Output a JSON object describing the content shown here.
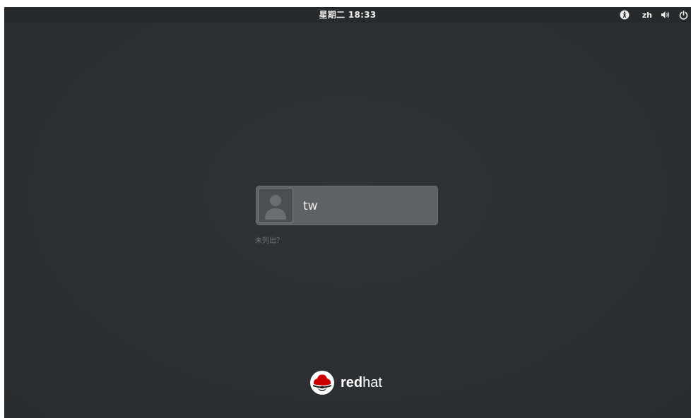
{
  "topbar": {
    "clock": "星期二 18:33",
    "tray": {
      "accessibility_icon": "accessibility-icon",
      "language": "zh",
      "volume_icon": "volume-icon",
      "power_icon": "power-icon"
    }
  },
  "login": {
    "users": [
      {
        "name": "tw",
        "avatar_icon": "user-avatar-icon"
      }
    ],
    "not_listed": "未列出？"
  },
  "branding": {
    "logo_icon": "redhat-logo-icon",
    "word_bold": "red",
    "word_regular": "hat"
  },
  "colors": {
    "background": "#2e3436",
    "card": "#5f6264",
    "text": "#eeeeec",
    "brand_red": "#cc0000"
  }
}
